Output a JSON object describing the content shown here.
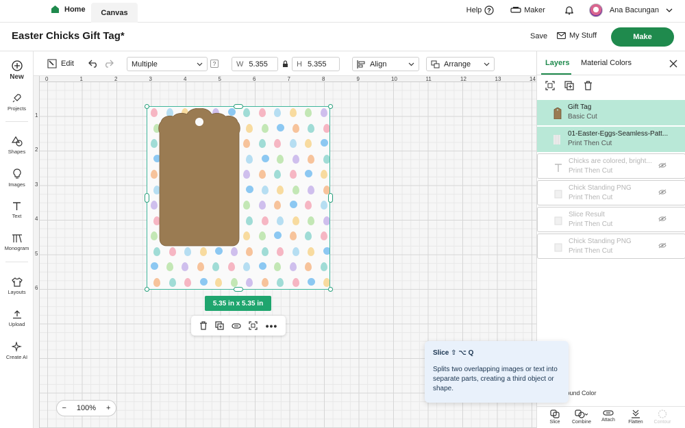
{
  "topbar": {
    "home_label": "Home",
    "canvas_tab_label": "Canvas",
    "help_label": "Help",
    "maker_label": "Maker",
    "user_name": "Ana Bacungan"
  },
  "titlebar": {
    "project_title": "Easter Chicks Gift Tag*",
    "save_label": "Save",
    "mystuff_label": "My Stuff",
    "make_label": "Make"
  },
  "sidebar": {
    "items": [
      {
        "label": "New",
        "icon": "plus-icon"
      },
      {
        "label": "Projects",
        "icon": "rocket-icon"
      },
      {
        "label": "Shapes",
        "icon": "shapes-icon"
      },
      {
        "label": "Images",
        "icon": "lightbulb-icon"
      },
      {
        "label": "Text",
        "icon": "text-icon"
      },
      {
        "label": "Monogram",
        "icon": "monogram-icon"
      },
      {
        "label": "Layouts",
        "icon": "tshirt-icon"
      },
      {
        "label": "Upload",
        "icon": "upload-icon"
      },
      {
        "label": "Create AI",
        "icon": "sparkle-icon"
      }
    ]
  },
  "toolbar": {
    "edit_label": "Edit",
    "operation_value": "Multiple",
    "width_label": "W",
    "width_value": "5.355",
    "height_label": "H",
    "height_value": "5.355",
    "align_label": "Align",
    "arrange_label": "Arrange"
  },
  "canvas": {
    "ruler_top": [
      "0",
      "1",
      "2",
      "3",
      "4",
      "5",
      "6",
      "7",
      "8",
      "9",
      "10",
      "11",
      "12",
      "13",
      "14"
    ],
    "ruler_left": [
      "1",
      "2",
      "3",
      "4",
      "5",
      "6"
    ],
    "size_badge": "5.35  in x 5.35  in",
    "zoom_value": "100%"
  },
  "panel": {
    "tabs": [
      "Layers",
      "Material Colors"
    ],
    "layers": [
      {
        "name": "Gift Tag",
        "sub": "Basic Cut",
        "selected": true,
        "hidden": false
      },
      {
        "name": "01-Easter-Eggs-Seamless-Patt...",
        "sub": "Print Then Cut",
        "selected": true,
        "hidden": false
      },
      {
        "name": "Chicks are colored, bright...",
        "sub": "Print Then Cut",
        "selected": false,
        "hidden": true
      },
      {
        "name": "Chick Standing PNG",
        "sub": "Print Then Cut",
        "selected": false,
        "hidden": true
      },
      {
        "name": "Slice Result",
        "sub": "Print Then Cut",
        "selected": false,
        "hidden": true
      },
      {
        "name": "Chick Standing PNG",
        "sub": "Print Then Cut",
        "selected": false,
        "hidden": true
      }
    ],
    "background_color_label": "kground Color",
    "bottom_actions": [
      "Slice",
      "Combine",
      "Attach",
      "Flatten",
      "Contour"
    ]
  },
  "tooltip": {
    "title": "Slice ⇧ ⌥ Q",
    "body": "Splits two overlapping images or text into separate parts, creating a third object or shape."
  },
  "colors": {
    "brand_green": "#1f8a4d",
    "selection_green": "#b9e8d7",
    "tag_brown": "#9a7b52",
    "badge_green": "#1fa56e",
    "tooltip_bg": "#e9f1fb"
  }
}
